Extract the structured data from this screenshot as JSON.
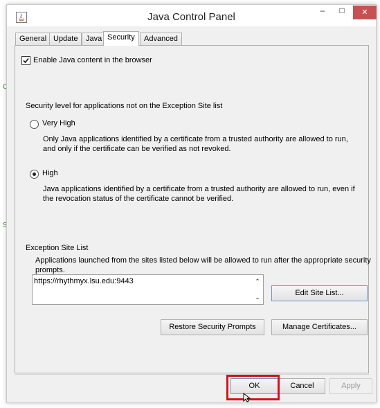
{
  "window": {
    "title": "Java Control Panel",
    "controls": {
      "minimize": "–",
      "maximize": "□",
      "close": "✕"
    }
  },
  "tabs": [
    {
      "label": "General",
      "active": false
    },
    {
      "label": "Update",
      "active": false
    },
    {
      "label": "Java",
      "active": false
    },
    {
      "label": "Security",
      "active": true
    },
    {
      "label": "Advanced",
      "active": false
    }
  ],
  "security": {
    "enable_java_label": "Enable Java content in the browser",
    "enable_java_checked": true,
    "level_heading": "Security level for applications not on the Exception Site list",
    "levels": [
      {
        "label": "Very High",
        "selected": false,
        "desc_line1": "Only Java applications identified by a certificate from a trusted authority are allowed to run,",
        "desc_line2": "and only if the certificate can be verified as not revoked."
      },
      {
        "label": "High",
        "selected": true,
        "desc_line1": "Java applications identified by a certificate from a trusted authority are allowed to run, even if",
        "desc_line2": "the revocation status of the certificate cannot be verified."
      }
    ],
    "exception": {
      "heading": "Exception Site List",
      "desc_line1": "Applications launched from the sites listed below will be allowed to run after the appropriate security",
      "desc_line2": "prompts.",
      "sites": [
        "https://rhythmyx.lsu.edu:9443"
      ],
      "edit_button": "Edit Site List..."
    },
    "restore_button": "Restore Security Prompts",
    "manage_button": "Manage Certificates..."
  },
  "footer": {
    "ok": "OK",
    "cancel": "Cancel",
    "apply": "Apply"
  },
  "colors": {
    "highlight": "#d2101f",
    "close_button": "#c75050"
  }
}
